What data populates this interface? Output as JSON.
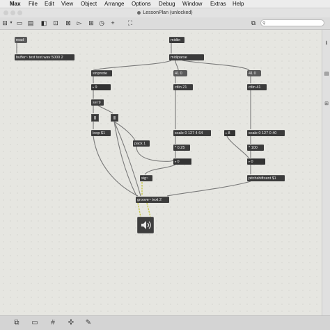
{
  "menubar": {
    "items": [
      "Max",
      "File",
      "Edit",
      "View",
      "Object",
      "Arrange",
      "Options",
      "Debug",
      "Window",
      "Extras",
      "Help"
    ]
  },
  "window": {
    "title": "LessonPlan (unlocked)"
  },
  "toolbar": {
    "search_placeholder": ""
  },
  "patch": {
    "objects": {
      "read": "read",
      "buffer": "buffer~ text text.wav 5000 2",
      "midiin": "midiin",
      "midiparse": "midiparse",
      "stripnote": "stripnote",
      "num_41_a": "41 0",
      "num_41_b": "41 0",
      "num_9": "9",
      "ctlin21": "ctlin 21",
      "ctlin41": "ctlin 41",
      "sel9": "sel 9",
      "loop": "loop $1",
      "scale1": "scale 0 127 4 64",
      "num_8": "8",
      "scale2": "scale 0 127 0 40",
      "pack": "pack 1",
      "mul025": "* 0.25",
      "mul100": "* 100",
      "num_0_a": "0",
      "num_0_b": "0",
      "sig": "sig~",
      "pitchshift": "pitchshiftcent $1",
      "groove": "groove~ text 2"
    }
  },
  "colors": {
    "canvas": "#e6e6e1",
    "object": "#3b3b3b",
    "signal_cord": "#c8c84a",
    "cord": "#7a7a7a"
  }
}
